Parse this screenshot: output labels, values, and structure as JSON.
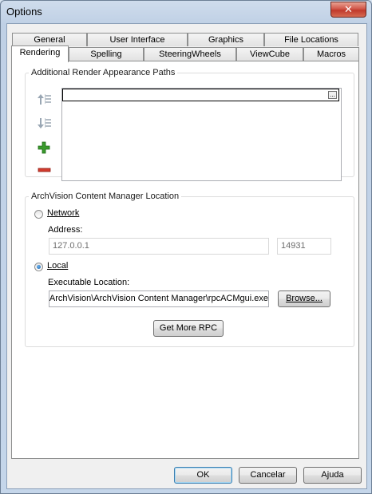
{
  "window": {
    "title": "Options",
    "close_glyph": "✕"
  },
  "tabs": {
    "row1": [
      "General",
      "User Interface",
      "Graphics",
      "File Locations"
    ],
    "row2": [
      "Rendering",
      "Spelling",
      "SteeringWheels",
      "ViewCube",
      "Macros"
    ],
    "active": "Rendering"
  },
  "render_paths": {
    "group_label": "Additional Render Appearance Paths",
    "list_items": [
      ""
    ],
    "browse_glyph": "...",
    "icons": [
      "move-up-icon",
      "move-down-icon",
      "add-icon",
      "remove-icon"
    ]
  },
  "archvision": {
    "group_label": "ArchVision Content Manager Location",
    "network_label": "Network",
    "network_selected": false,
    "address_label": "Address:",
    "address_value": "127.0.0.1",
    "port_value": "14931",
    "local_label": "Local",
    "local_selected": true,
    "exe_label": "Executable Location:",
    "exe_value": "ArchVision\\ArchVision Content Manager\\rpcACMgui.exe",
    "browse_label": "Browse...",
    "get_more_label": "Get More RPC"
  },
  "footer": {
    "ok": "OK",
    "cancel": "Cancelar",
    "help": "Ajuda"
  },
  "colors": {
    "accent": "#3c7fb1",
    "close": "#c0392b",
    "add": "#3a9a2c",
    "remove": "#d33c2f"
  }
}
